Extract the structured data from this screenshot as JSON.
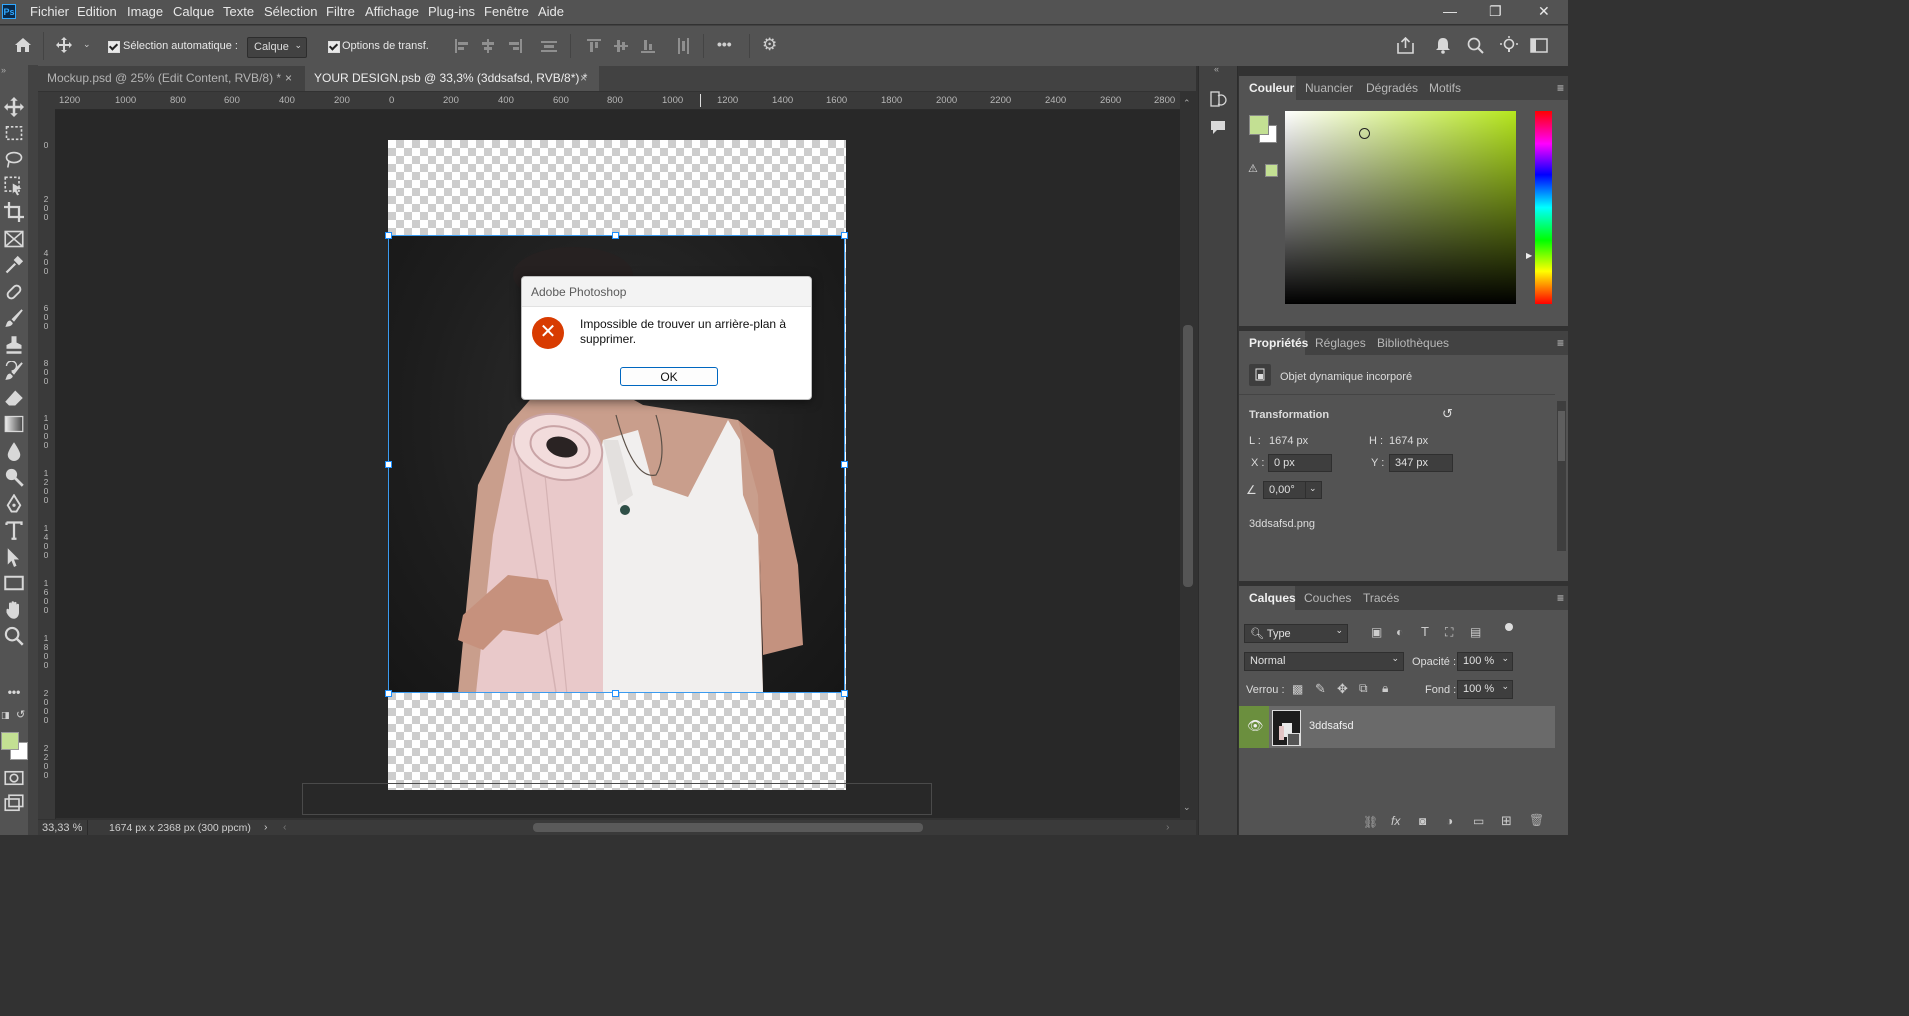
{
  "app": {
    "logo": "Ps",
    "menu": [
      "Fichier",
      "Edition",
      "Image",
      "Calque",
      "Texte",
      "Sélection",
      "Filtre",
      "Affichage",
      "Plug-ins",
      "Fenêtre",
      "Aide"
    ],
    "window_controls": [
      "—",
      "❐",
      "✕"
    ]
  },
  "options_bar": {
    "auto_select_label": "Sélection automatique :",
    "auto_select_value": "Calque",
    "transform_options_label": "Options de transf.",
    "more_label": "•••",
    "icons": [
      "home-icon",
      "move-tool-icon",
      "align-left-icon",
      "align-center-icon",
      "align-right-icon",
      "distribute-icon",
      "align-top-icon",
      "align-middle-icon",
      "align-bottom-icon",
      "distribute-vertical-icon",
      "more-icon",
      "settings-icon",
      "share-icon",
      "notifications-icon",
      "search-icon",
      "discover-icon",
      "workspace-icon"
    ]
  },
  "tabs": [
    {
      "label": "Mockup.psd @ 25% (Edit Content, RVB/8) *",
      "close": "×",
      "active": false
    },
    {
      "label": "YOUR DESIGN.psb @ 33,3% (3ddsafsd, RVB/8*) *",
      "close": "×",
      "active": true
    }
  ],
  "ruler": {
    "h_ticks": [
      "1200",
      "1000",
      "800",
      "600",
      "400",
      "200",
      "0",
      "200",
      "400",
      "600",
      "800",
      "1000",
      "1200",
      "1400",
      "1600",
      "1800",
      "2000",
      "2200",
      "2400",
      "2600",
      "2800"
    ],
    "v_ticks": [
      "0",
      "200",
      "400",
      "600",
      "800",
      "1000",
      "1200",
      "1400",
      "1600",
      "1800",
      "2000",
      "2200"
    ]
  },
  "dialog": {
    "title": "Adobe Photoshop",
    "message": "Impossible de trouver un arrière-plan à supprimer.",
    "ok_label": "OK",
    "icon": "error-icon"
  },
  "status": {
    "zoom": "33,33 %",
    "doc_info": "1674 px x 2368 px (300 ppcm)",
    "arrow": "›"
  },
  "color_panel": {
    "tabs": [
      "Couleur",
      "Nuancier",
      "Dégradés",
      "Motifs"
    ],
    "fg_color": "#c3e093",
    "bg_color": "#ffffff",
    "gamut_swatch": "#c3e093",
    "hue_color": "#b5e61d"
  },
  "properties_panel": {
    "tabs": [
      "Propriétés",
      "Réglages",
      "Bibliothèques"
    ],
    "object_type": "Objet dynamique incorporé",
    "section_title": "Transformation",
    "w_label": "L :",
    "w_value": "1674 px",
    "h_label": "H :",
    "h_value": "1674 px",
    "x_label": "X :",
    "x_value": "0 px",
    "y_label": "Y :",
    "y_value": "347 px",
    "angle_value": "0,00°",
    "linked_file": "3ddsafsd.png"
  },
  "layers_panel": {
    "tabs": [
      "Calques",
      "Couches",
      "Tracés"
    ],
    "filter_label": "Type",
    "blend_mode": "Normal",
    "opacity_label": "Opacité :",
    "opacity_value": "100 %",
    "lock_label": "Verrou :",
    "fill_label": "Fond :",
    "fill_value": "100 %",
    "layers": [
      {
        "name": "3ddsafsd",
        "visible": true,
        "selected": true
      }
    ]
  }
}
